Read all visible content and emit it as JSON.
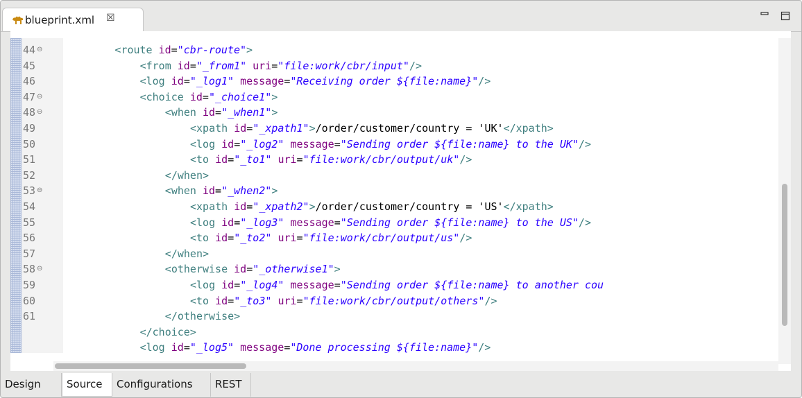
{
  "editor_tab": {
    "title": "blueprint.xml",
    "close_glyph": "☒",
    "icon": "camel-icon"
  },
  "window_controls": {
    "minimize_icon": "minimize-icon",
    "maximize_icon": "maximize-icon"
  },
  "bottom_tabs": [
    {
      "label": "Design",
      "active": false
    },
    {
      "label": "Source",
      "active": true
    },
    {
      "label": "Configurations",
      "active": false
    },
    {
      "label": "REST",
      "active": false
    }
  ],
  "colors": {
    "tag": "#3f7f7f",
    "attribute": "#7f007f",
    "value": "#2a00ff",
    "text": "#000000",
    "line_number": "#787878"
  },
  "code_lines": [
    {
      "line_number": "44",
      "foldable": true,
      "indent": 8,
      "tokens": [
        [
          "tag",
          "<route "
        ],
        [
          "attr",
          "id"
        ],
        [
          "plain",
          "="
        ],
        [
          "val",
          "\"cbr-route\""
        ],
        [
          "tag",
          ">"
        ]
      ]
    },
    {
      "line_number": "45",
      "foldable": false,
      "indent": 12,
      "tokens": [
        [
          "tag",
          "<from "
        ],
        [
          "attr",
          "id"
        ],
        [
          "plain",
          "="
        ],
        [
          "val",
          "\"_from1\""
        ],
        [
          "plain",
          " "
        ],
        [
          "attr",
          "uri"
        ],
        [
          "plain",
          "="
        ],
        [
          "val",
          "\"file:work/cbr/input\""
        ],
        [
          "tag",
          "/>"
        ]
      ]
    },
    {
      "line_number": "46",
      "foldable": false,
      "indent": 12,
      "tokens": [
        [
          "tag",
          "<log "
        ],
        [
          "attr",
          "id"
        ],
        [
          "plain",
          "="
        ],
        [
          "val",
          "\"_log1\""
        ],
        [
          "plain",
          " "
        ],
        [
          "attr",
          "message"
        ],
        [
          "plain",
          "="
        ],
        [
          "val",
          "\"Receiving order ${file:name}\""
        ],
        [
          "tag",
          "/>"
        ]
      ]
    },
    {
      "line_number": "47",
      "foldable": true,
      "indent": 12,
      "tokens": [
        [
          "tag",
          "<choice "
        ],
        [
          "attr",
          "id"
        ],
        [
          "plain",
          "="
        ],
        [
          "val",
          "\"_choice1\""
        ],
        [
          "tag",
          ">"
        ]
      ]
    },
    {
      "line_number": "48",
      "foldable": true,
      "indent": 16,
      "tokens": [
        [
          "tag",
          "<when "
        ],
        [
          "attr",
          "id"
        ],
        [
          "plain",
          "="
        ],
        [
          "val",
          "\"_when1\""
        ],
        [
          "tag",
          ">"
        ]
      ]
    },
    {
      "line_number": "49",
      "foldable": false,
      "indent": 20,
      "tokens": [
        [
          "tag",
          "<xpath "
        ],
        [
          "attr",
          "id"
        ],
        [
          "plain",
          "="
        ],
        [
          "val",
          "\"_xpath1\""
        ],
        [
          "tag",
          ">"
        ],
        [
          "plain",
          "/order/customer/country = 'UK'"
        ],
        [
          "tag",
          "</xpath>"
        ]
      ]
    },
    {
      "line_number": "50",
      "foldable": false,
      "indent": 20,
      "tokens": [
        [
          "tag",
          "<log "
        ],
        [
          "attr",
          "id"
        ],
        [
          "plain",
          "="
        ],
        [
          "val",
          "\"_log2\""
        ],
        [
          "plain",
          " "
        ],
        [
          "attr",
          "message"
        ],
        [
          "plain",
          "="
        ],
        [
          "val",
          "\"Sending order ${file:name} to the UK\""
        ],
        [
          "tag",
          "/>"
        ]
      ]
    },
    {
      "line_number": "51",
      "foldable": false,
      "indent": 20,
      "tokens": [
        [
          "tag",
          "<to "
        ],
        [
          "attr",
          "id"
        ],
        [
          "plain",
          "="
        ],
        [
          "val",
          "\"_to1\""
        ],
        [
          "plain",
          " "
        ],
        [
          "attr",
          "uri"
        ],
        [
          "plain",
          "="
        ],
        [
          "val",
          "\"file:work/cbr/output/uk\""
        ],
        [
          "tag",
          "/>"
        ]
      ]
    },
    {
      "line_number": "52",
      "foldable": false,
      "indent": 16,
      "tokens": [
        [
          "tag",
          "</when>"
        ]
      ]
    },
    {
      "line_number": "53",
      "foldable": true,
      "indent": 16,
      "tokens": [
        [
          "tag",
          "<when "
        ],
        [
          "attr",
          "id"
        ],
        [
          "plain",
          "="
        ],
        [
          "val",
          "\"_when2\""
        ],
        [
          "tag",
          ">"
        ]
      ]
    },
    {
      "line_number": "54",
      "foldable": false,
      "indent": 20,
      "tokens": [
        [
          "tag",
          "<xpath "
        ],
        [
          "attr",
          "id"
        ],
        [
          "plain",
          "="
        ],
        [
          "val",
          "\"_xpath2\""
        ],
        [
          "tag",
          ">"
        ],
        [
          "plain",
          "/order/customer/country = 'US'"
        ],
        [
          "tag",
          "</xpath>"
        ]
      ]
    },
    {
      "line_number": "55",
      "foldable": false,
      "indent": 20,
      "tokens": [
        [
          "tag",
          "<log "
        ],
        [
          "attr",
          "id"
        ],
        [
          "plain",
          "="
        ],
        [
          "val",
          "\"_log3\""
        ],
        [
          "plain",
          " "
        ],
        [
          "attr",
          "message"
        ],
        [
          "plain",
          "="
        ],
        [
          "val",
          "\"Sending order ${file:name} to the US\""
        ],
        [
          "tag",
          "/>"
        ]
      ]
    },
    {
      "line_number": "56",
      "foldable": false,
      "indent": 20,
      "tokens": [
        [
          "tag",
          "<to "
        ],
        [
          "attr",
          "id"
        ],
        [
          "plain",
          "="
        ],
        [
          "val",
          "\"_to2\""
        ],
        [
          "plain",
          " "
        ],
        [
          "attr",
          "uri"
        ],
        [
          "plain",
          "="
        ],
        [
          "val",
          "\"file:work/cbr/output/us\""
        ],
        [
          "tag",
          "/>"
        ]
      ]
    },
    {
      "line_number": "57",
      "foldable": false,
      "indent": 16,
      "tokens": [
        [
          "tag",
          "</when>"
        ]
      ]
    },
    {
      "line_number": "58",
      "foldable": true,
      "indent": 16,
      "tokens": [
        [
          "tag",
          "<otherwise "
        ],
        [
          "attr",
          "id"
        ],
        [
          "plain",
          "="
        ],
        [
          "val",
          "\"_otherwise1\""
        ],
        [
          "tag",
          ">"
        ]
      ]
    },
    {
      "line_number": "59",
      "foldable": false,
      "indent": 20,
      "tokens": [
        [
          "tag",
          "<log "
        ],
        [
          "attr",
          "id"
        ],
        [
          "plain",
          "="
        ],
        [
          "val",
          "\"_log4\""
        ],
        [
          "plain",
          " "
        ],
        [
          "attr",
          "message"
        ],
        [
          "plain",
          "="
        ],
        [
          "val",
          "\"Sending order ${file:name} to another cou"
        ]
      ]
    },
    {
      "line_number": "60",
      "foldable": false,
      "indent": 20,
      "tokens": [
        [
          "tag",
          "<to "
        ],
        [
          "attr",
          "id"
        ],
        [
          "plain",
          "="
        ],
        [
          "val",
          "\"_to3\""
        ],
        [
          "plain",
          " "
        ],
        [
          "attr",
          "uri"
        ],
        [
          "plain",
          "="
        ],
        [
          "val",
          "\"file:work/cbr/output/others\""
        ],
        [
          "tag",
          "/>"
        ]
      ]
    },
    {
      "line_number": "61",
      "foldable": false,
      "indent": 16,
      "tokens": [
        [
          "tag",
          "</otherwise>"
        ]
      ]
    },
    {
      "line_number": "",
      "foldable": false,
      "indent": 12,
      "tokens": [
        [
          "tag",
          "</choice>"
        ]
      ]
    },
    {
      "line_number": "",
      "foldable": false,
      "indent": 12,
      "tokens": [
        [
          "tag",
          "<log "
        ],
        [
          "attr",
          "id"
        ],
        [
          "plain",
          "="
        ],
        [
          "val",
          "\"_log5\""
        ],
        [
          "plain",
          " "
        ],
        [
          "attr",
          "message"
        ],
        [
          "plain",
          "="
        ],
        [
          "val",
          "\"Done processing ${file:name}\""
        ],
        [
          "tag",
          "/>"
        ]
      ]
    }
  ]
}
